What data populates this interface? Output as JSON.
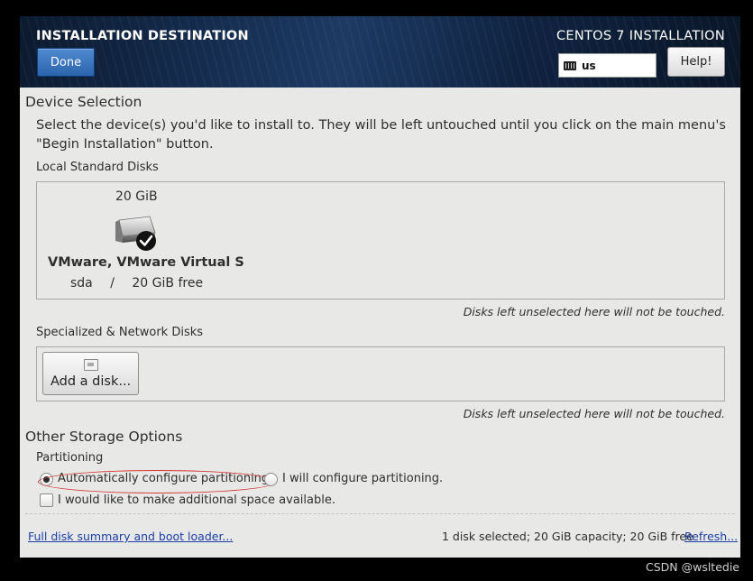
{
  "header": {
    "title": "INSTALLATION DESTINATION",
    "product": "CENTOS 7 INSTALLATION",
    "done_label": "Done",
    "keyboard_layout": "us",
    "help_label": "Help!"
  },
  "device_selection": {
    "heading": "Device Selection",
    "instructions_line1": "Select the device(s) you'd like to install to.  They will be left untouched until you click on the main menu's",
    "instructions_line2": "\"Begin Installation\" button.",
    "local_heading": "Local Standard Disks",
    "disk": {
      "size": "20 GiB",
      "name": "VMware, VMware Virtual S",
      "device": "sda",
      "separator": "/",
      "free": "20 GiB free",
      "selected": true
    },
    "local_note": "Disks left unselected here will not be touched.",
    "specialized_heading": "Specialized & Network Disks",
    "add_disk_label": "Add a disk...",
    "specialized_note": "Disks left unselected here will not be touched."
  },
  "other_storage": {
    "heading": "Other Storage Options",
    "partitioning_heading": "Partitioning",
    "auto_label": "Automatically configure partitioning.",
    "auto_selected": true,
    "manual_label": "I will configure partitioning.",
    "manual_selected": false,
    "space_label": "I would like to make additional space available.",
    "space_checked": false
  },
  "footer": {
    "summary_link": "Full disk summary and boot loader...",
    "summary_text": "1 disk selected; 20 GiB capacity; 20 GiB free",
    "refresh_link": "Refresh..."
  },
  "watermark": "CSDN @wsltedie",
  "colors": {
    "done_button": "#3a74bf",
    "link": "#1c3ea5",
    "annotation": "#d23a3a"
  }
}
